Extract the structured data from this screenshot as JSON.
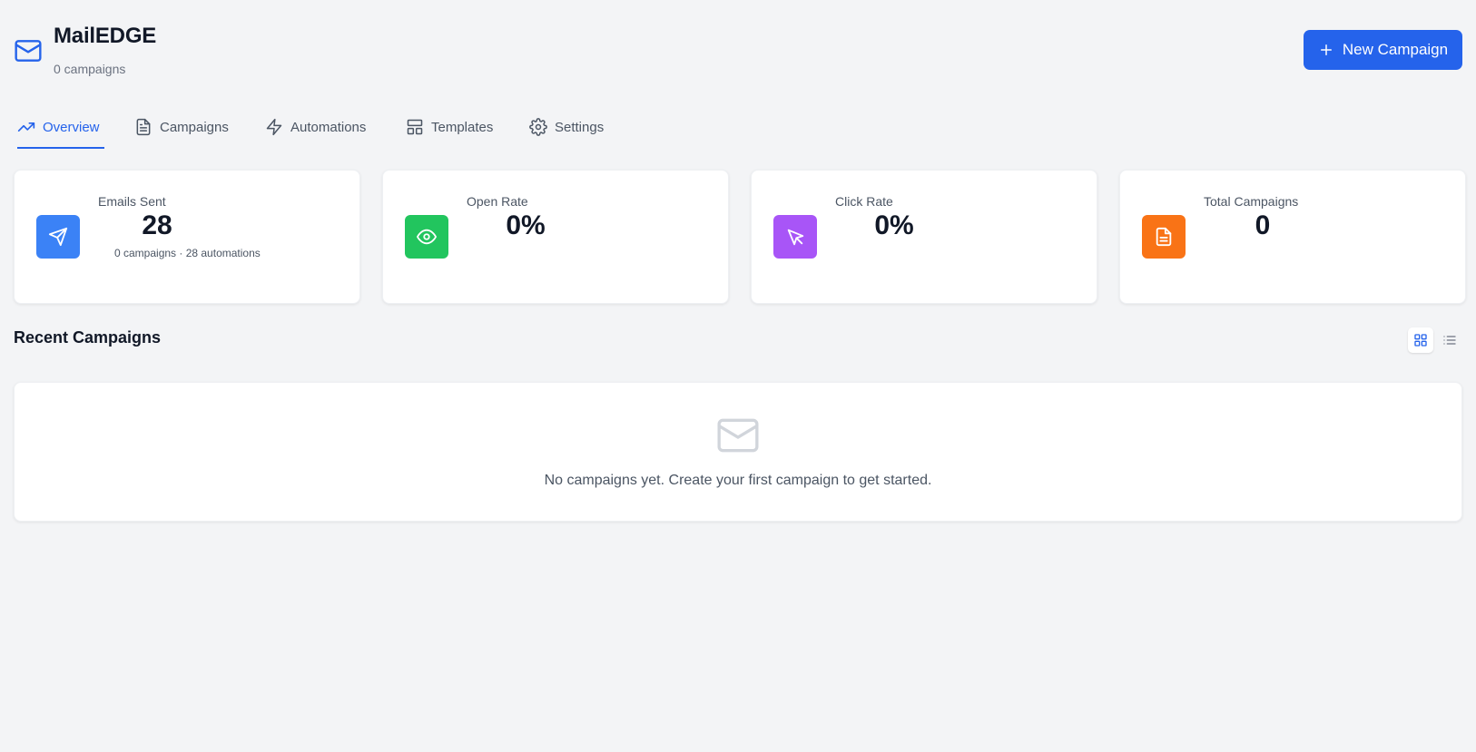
{
  "brand": {
    "title": "MailEDGE",
    "subtitle": "0 campaigns",
    "icon": "mail-icon"
  },
  "actions": {
    "new_campaign_label": "New Campaign"
  },
  "tabs": [
    {
      "label": "Overview",
      "icon": "trending-up-icon",
      "active": true
    },
    {
      "label": "Campaigns",
      "icon": "file-text-icon",
      "active": false
    },
    {
      "label": "Automations",
      "icon": "zap-icon",
      "active": false
    },
    {
      "label": "Templates",
      "icon": "layout-icon",
      "active": false
    },
    {
      "label": "Settings",
      "icon": "gear-icon",
      "active": false
    }
  ],
  "stats": [
    {
      "label": "Emails Sent",
      "value": "28",
      "sub": "0 campaigns · 28 automations",
      "icon": "send-icon",
      "color": "#3b82f6"
    },
    {
      "label": "Open Rate",
      "value": "0%",
      "sub": "",
      "icon": "eye-icon",
      "color": "#22c55e"
    },
    {
      "label": "Click Rate",
      "value": "0%",
      "sub": "",
      "icon": "cursor-icon",
      "color": "#a855f7"
    },
    {
      "label": "Total Campaigns",
      "value": "0",
      "sub": "",
      "icon": "file-icon",
      "color": "#f97316"
    }
  ],
  "recent": {
    "title": "Recent Campaigns",
    "view_mode": "grid",
    "empty_message": "No campaigns yet. Create your first campaign to get started."
  },
  "colors": {
    "accent": "#2563eb",
    "background": "#f3f4f6"
  }
}
